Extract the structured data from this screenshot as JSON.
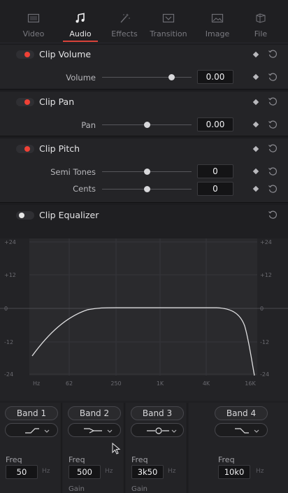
{
  "tabs": [
    {
      "label": "Video",
      "icon": "video-icon",
      "active": false
    },
    {
      "label": "Audio",
      "icon": "music-note-icon",
      "active": true
    },
    {
      "label": "Effects",
      "icon": "magic-wand-icon",
      "active": false
    },
    {
      "label": "Transition",
      "icon": "transition-icon",
      "active": false
    },
    {
      "label": "Image",
      "icon": "image-icon",
      "active": false
    },
    {
      "label": "File",
      "icon": "file-icon",
      "active": false
    }
  ],
  "clip_volume": {
    "title": "Clip Volume",
    "enabled": true,
    "params": [
      {
        "label": "Volume",
        "value": "0.00",
        "level": 0.78
      }
    ]
  },
  "clip_pan": {
    "title": "Clip Pan",
    "enabled": true,
    "params": [
      {
        "label": "Pan",
        "value": "0.00",
        "level": 0.5
      }
    ]
  },
  "clip_pitch": {
    "title": "Clip Pitch",
    "enabled": true,
    "params": [
      {
        "label": "Semi Tones",
        "value": "0",
        "level": 0.5
      },
      {
        "label": "Cents",
        "value": "0",
        "level": 0.5
      }
    ]
  },
  "clip_equalizer": {
    "title": "Clip Equalizer",
    "enabled": false,
    "y_ticks": [
      "+24",
      "+12",
      "0",
      "-12",
      "-24"
    ],
    "x_ticks": [
      "Hz",
      "62",
      "250",
      "1K",
      "4K",
      "16K"
    ],
    "bands": [
      {
        "label": "Band 1",
        "shape": "low-shelf",
        "freq_label": "Freq",
        "freq": "50",
        "unit": "Hz",
        "gain_label": ""
      },
      {
        "label": "Band 2",
        "shape": "bell",
        "freq_label": "Freq",
        "freq": "500",
        "unit": "Hz",
        "gain_label": "Gain"
      },
      {
        "label": "Band 3",
        "shape": "notch",
        "freq_label": "Freq",
        "freq": "3k50",
        "unit": "Hz",
        "gain_label": "Gain"
      },
      {
        "label": "Band 4",
        "shape": "high-shelf",
        "freq_label": "Freq",
        "freq": "10k0",
        "unit": "Hz",
        "gain_label": ""
      }
    ]
  },
  "colors": {
    "accent": "#ef4136",
    "curve": "#e0e0e2",
    "background": "#1c1c1f"
  }
}
